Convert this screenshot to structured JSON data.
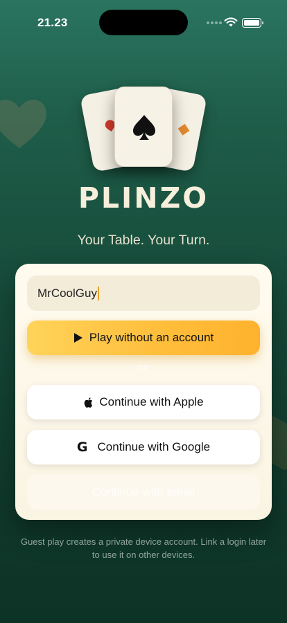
{
  "status_bar": {
    "time": "21.23",
    "icons": [
      "signal-icon",
      "wifi-icon",
      "battery-icon"
    ]
  },
  "app": {
    "name": "PLINZO",
    "tagline": "Your Table. Your Turn.",
    "logo_icons": [
      "playing-cards-icon",
      "spade-icon"
    ]
  },
  "colors": {
    "background_top": "#2a7560",
    "background_bottom": "#0d3226",
    "accent": "#ffbd3a",
    "panel": "#faf4e3"
  },
  "form": {
    "name_input_value": "MrCoolGuy",
    "play_button_label": "Play without an account",
    "divider_label": "OR",
    "apple_button_label": "Continue with Apple",
    "google_button_label": "Continue with Google",
    "google_icon_glyph": "G",
    "email_button_label": "Continue with email"
  },
  "footnote": "Guest play creates a private device account. Link a login later to use it on other devices."
}
